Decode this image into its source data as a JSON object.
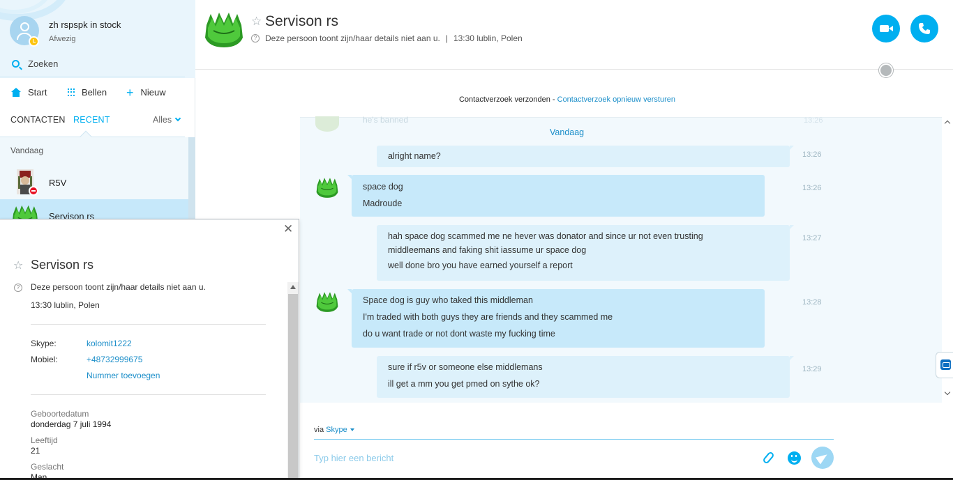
{
  "sidebar": {
    "profile": {
      "name": "zh rspspk in stock",
      "status": "Afwezig"
    },
    "search_label": "Zoeken",
    "nav": {
      "start": "Start",
      "bellen": "Bellen",
      "nieuw": "Nieuw"
    },
    "tabs": {
      "contacts": "CONTACTEN",
      "recent": "RECENT",
      "filter": "Alles"
    },
    "section_label": "Vandaag",
    "contacts": [
      {
        "name": "R5V"
      },
      {
        "name": "Servison rs"
      }
    ]
  },
  "header": {
    "name": "Servison rs",
    "privacy": "Deze persoon toont zijn/haar details niet aan u.",
    "separator": "|",
    "local_time": "13:30 lublin, Polen"
  },
  "request": {
    "text": "Contactverzoek verzonden - ",
    "link": "Contactverzoek opnieuw versturen"
  },
  "chat": {
    "faded_text": "he's banned",
    "faded_time": "13:26",
    "day_label": "Vandaag",
    "messages": [
      {
        "dir": "out",
        "time": "13:26",
        "lines": [
          "alright name?"
        ]
      },
      {
        "dir": "in",
        "time": "13:26",
        "lines": [
          "space dog",
          "Madroude"
        ]
      },
      {
        "dir": "out",
        "time": "13:27",
        "lines": [
          "hah space dog scammed me ne hever was donator and since ur not even trusting",
          "middleemans and faking shit iassume ur space dog",
          "well done bro you have earned yourself a report"
        ]
      },
      {
        "dir": "in",
        "time": "13:28",
        "lines": [
          "Space dog is guy who taked this middleman",
          "I'm traded with both guys they are friends and they scammed me",
          "do u want trade or not dont waste my fucking time"
        ]
      },
      {
        "dir": "out",
        "time": "13:29",
        "lines": [
          "sure if r5v or someone else middlemans",
          "ill get a mm you get pmed on sythe  ok?"
        ]
      }
    ]
  },
  "composer": {
    "via_prefix": "via",
    "via_link": "Skype",
    "placeholder": "Typ hier een bericht"
  },
  "popup": {
    "name": "Servison rs",
    "privacy": "Deze persoon toont zijn/haar details niet aan u.",
    "local_time": "13:30 lublin, Polen",
    "skype_label": "Skype:",
    "skype_value": "kolomit1222",
    "mobile_label": "Mobiel:",
    "mobile_value": "+48732999675",
    "add_number": "Nummer toevoegen",
    "birthday_caption": "Geboortedatum",
    "birthday_value": "donderdag 7 juli 1994",
    "age_caption": "Leeftijd",
    "age_value": "21",
    "gender_caption": "Geslacht",
    "gender_value": "Man"
  },
  "colors": {
    "accent": "#00aff0",
    "link": "#1b8ec9",
    "incoming_bubble": "#c7e9fa",
    "outgoing_bubble": "#ddf1fb",
    "chat_background": "#f2f9fd",
    "away": "#fdc40e",
    "do_not_disturb": "#e81123"
  }
}
